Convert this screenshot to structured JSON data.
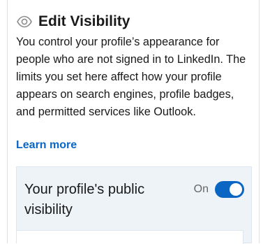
{
  "header": {
    "icon": "eye-icon",
    "title": "Edit Visibility"
  },
  "description": "You control your profile’s appearance for people who are not signed in to LinkedIn. The limits you set here affect how your profile appears on search engines, profile badges, and permitted services like Outlook.",
  "learn_more": "Learn more",
  "public_visibility": {
    "label": "Your profile's public visibility",
    "state_label": "On",
    "enabled": true
  },
  "colors": {
    "accent": "#0a66c2",
    "panel": "#eef3f8",
    "text": "#191919",
    "muted": "#666666"
  }
}
